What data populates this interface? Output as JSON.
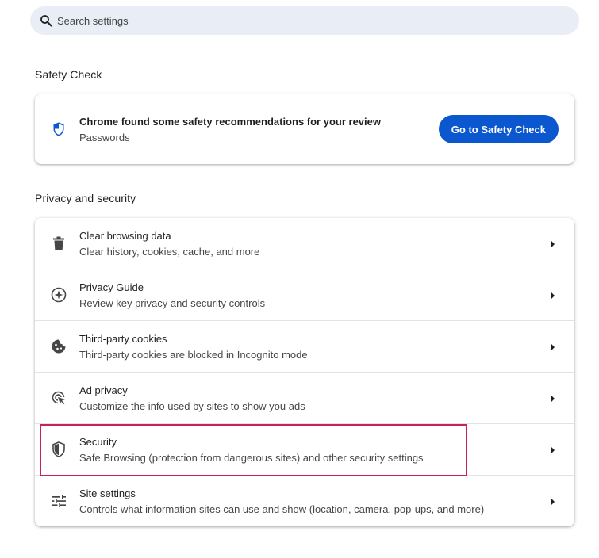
{
  "search": {
    "placeholder": "Search settings"
  },
  "safety_check": {
    "section_title": "Safety Check",
    "message": "Chrome found some safety recommendations for your review",
    "sub_message": "Passwords",
    "button_label": "Go to Safety Check"
  },
  "privacy": {
    "section_title": "Privacy and security",
    "items": [
      {
        "title": "Clear browsing data",
        "subtitle": "Clear history, cookies, cache, and more",
        "icon": "trash-icon"
      },
      {
        "title": "Privacy Guide",
        "subtitle": "Review key privacy and security controls",
        "icon": "compass-icon"
      },
      {
        "title": "Third-party cookies",
        "subtitle": "Third-party cookies are blocked in Incognito mode",
        "icon": "cookie-icon"
      },
      {
        "title": "Ad privacy",
        "subtitle": "Customize the info used by sites to show you ads",
        "icon": "ad-privacy-icon"
      },
      {
        "title": "Security",
        "subtitle": "Safe Browsing (protection from dangerous sites) and other security settings",
        "icon": "shield-icon"
      },
      {
        "title": "Site settings",
        "subtitle": "Controls what information sites can use and show (location, camera, pop-ups, and more)",
        "icon": "sliders-icon"
      }
    ]
  },
  "colors": {
    "accent": "#0b57d0",
    "highlight": "#c8205b",
    "search_bg": "#e9eef6"
  }
}
